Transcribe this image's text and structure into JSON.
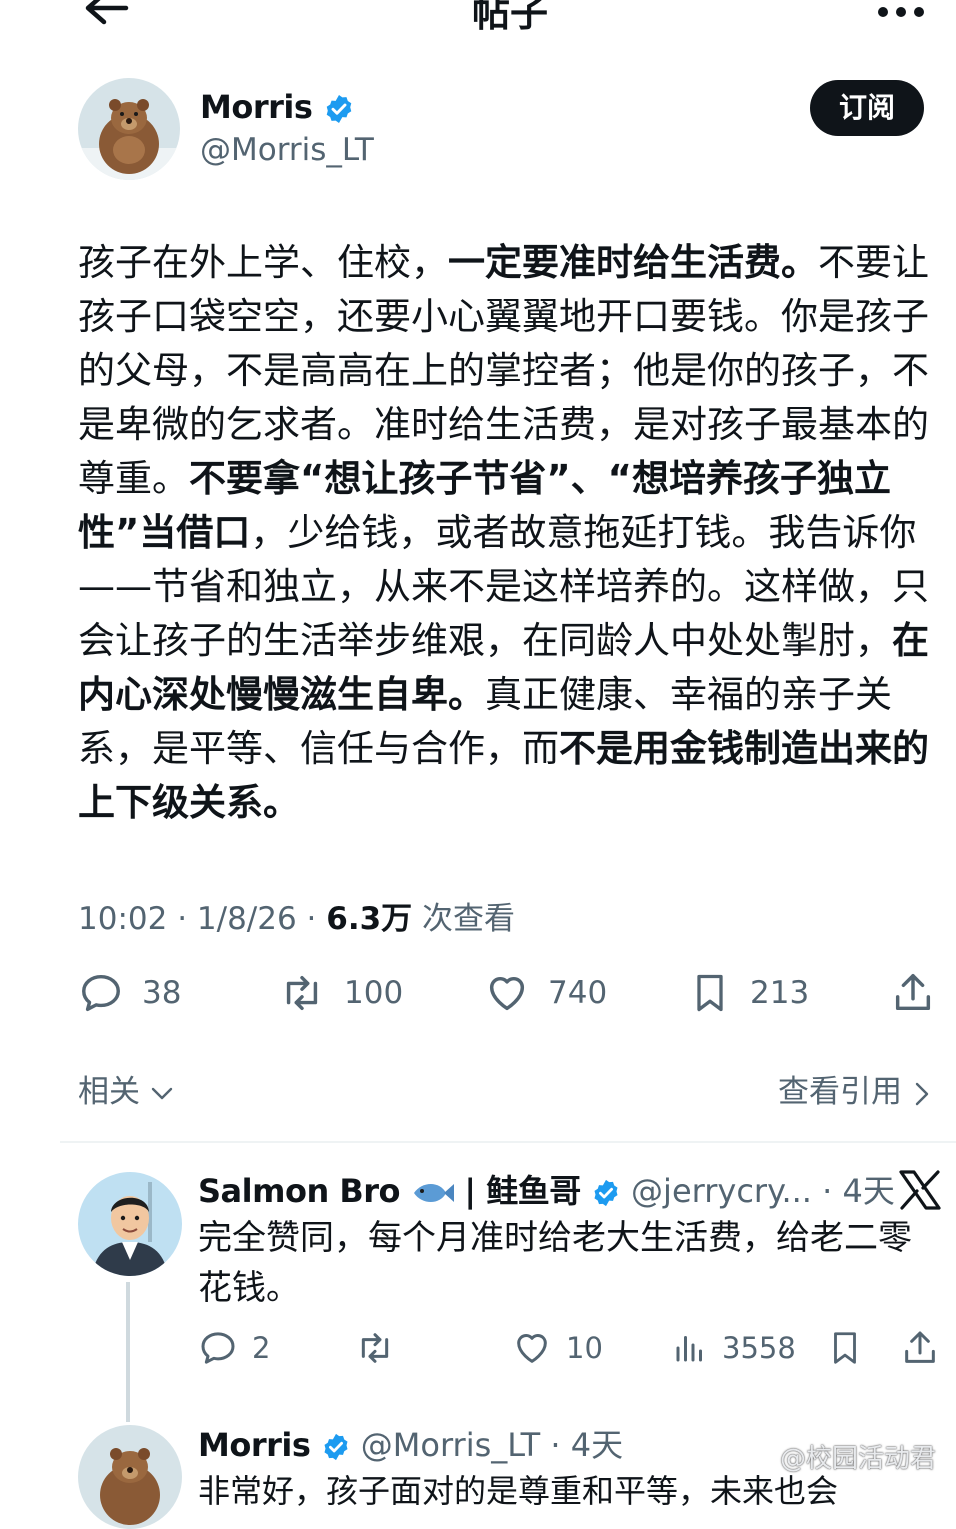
{
  "header": {
    "title": "帖子",
    "back_icon": "arrow-left-icon",
    "more_icon": "more-dots-icon"
  },
  "author": {
    "name": "Morris",
    "handle": "@Morris_LT",
    "subscribe_label": "订阅"
  },
  "post": {
    "segments": [
      {
        "text": "孩子在外上学、住校，",
        "bold": false
      },
      {
        "text": "一定要准时给生活费。",
        "bold": true
      },
      {
        "text": "不要让孩子口袋空空，还要小心翼翼地开口要钱。你是孩子的父母，不是高高在上的掌控者；他是你的孩子，不是卑微的乞求者。准时给生活费，是对孩子最基本的尊重。",
        "bold": false
      },
      {
        "text": "不要拿“想让孩子节省”、“想培养孩子独立性”当借口",
        "bold": true
      },
      {
        "text": "，少给钱，或者故意拖延打钱。我告诉你——节省和独立，从来不是这样培养的。这样做，只会让孩子的生活举步维艰，在同龄人中处处掣肘，",
        "bold": false
      },
      {
        "text": "在内心深处慢慢滋生自卑。",
        "bold": true
      },
      {
        "text": "真正健康、幸福的亲子关系，是平等、信任与合作，而",
        "bold": false
      },
      {
        "text": "不是用金钱制造出来的上下级关系。",
        "bold": true
      }
    ],
    "time": "10:02 · 1/8/26 · ",
    "views": "6.3万",
    "views_suffix": " 次查看"
  },
  "actions": {
    "replies": "38",
    "reposts": "100",
    "likes": "740",
    "bookmarks": "213"
  },
  "related": {
    "label": "相关",
    "quotes_label": "查看引用"
  },
  "reply": {
    "name": "Salmon Bro",
    "name_cn": "| 鲑鱼哥",
    "handle_time": "@jerrycry... · 4天",
    "text": "完全赞同，每个月准时给老大生活费，给老二零花钱。",
    "replies": "2",
    "likes": "10",
    "views": "3558"
  },
  "third": {
    "name": "Morris",
    "handle_time": "@Morris_LT · 4天",
    "text": "非常好，孩子面对的是尊重和平等，未来也会"
  },
  "watermark": "@校园活动君",
  "colors": {
    "accent": "#1d9bf0",
    "muted": "#536471",
    "text": "#0f1419"
  }
}
